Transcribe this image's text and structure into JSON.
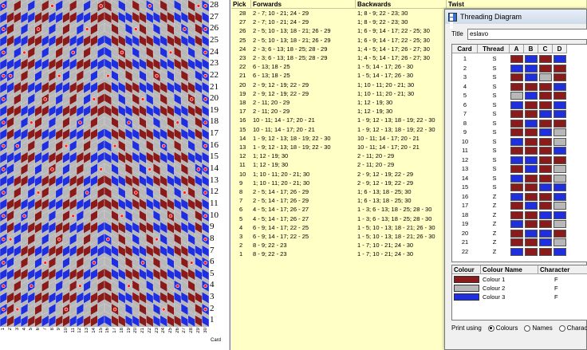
{
  "pattern": {
    "colors": {
      "bg": "#b8b8b8",
      "red": "#8b1a1a",
      "blue": "#1f2fe0",
      "dot_fill": "#ff2020"
    },
    "pick_numbers": [
      "28",
      "27",
      "26",
      "25",
      "24",
      "23",
      "22",
      "21",
      "20",
      "19",
      "18",
      "17",
      "16",
      "15",
      "14",
      "13",
      "12",
      "11",
      "10",
      "9",
      "8",
      "7",
      "6",
      "5",
      "4",
      "3",
      "2",
      "1"
    ],
    "card_numbers": [
      "1",
      "2",
      "3",
      "4",
      "5",
      "6",
      "7",
      "8",
      "9",
      "10",
      "11",
      "12",
      "13",
      "14",
      "15",
      "16",
      "17",
      "18",
      "19",
      "20",
      "21",
      "22",
      "23",
      "24",
      "25",
      "26",
      "27",
      "28",
      "29",
      "30"
    ],
    "card_axis_label": "Card"
  },
  "table": {
    "headers": {
      "pick": "Pick",
      "forwards": "Forwards",
      "backwards": "Backwards",
      "twist": "Twist"
    },
    "rows": [
      {
        "pick": "28",
        "fwd": "2 - 7; 10 - 21; 24 - 29",
        "bwd": "1; 8 - 9; 22 - 23; 30"
      },
      {
        "pick": "27",
        "fwd": "2 - 7; 10 - 21; 24 - 29",
        "bwd": "1; 8 - 9; 22 - 23; 30"
      },
      {
        "pick": "26",
        "fwd": "2 - 5; 10 - 13; 18 - 21; 26 - 29",
        "bwd": "1; 6 - 9; 14 - 17; 22 - 25; 30"
      },
      {
        "pick": "25",
        "fwd": "2 - 5; 10 - 13; 18 - 21; 26 - 29",
        "bwd": "1; 6 - 9; 14 - 17; 22 - 25; 30"
      },
      {
        "pick": "24",
        "fwd": "2 - 3; 6 - 13; 18 - 25; 28 - 29",
        "bwd": "1; 4 - 5; 14 - 17; 26 - 27; 30"
      },
      {
        "pick": "23",
        "fwd": "2 - 3; 6 - 13; 18 - 25; 28 - 29",
        "bwd": "1; 4 - 5; 14 - 17; 26 - 27; 30"
      },
      {
        "pick": "22",
        "fwd": "6 - 13; 18 - 25",
        "bwd": "1 - 5; 14 - 17; 26 - 30"
      },
      {
        "pick": "21",
        "fwd": "6 - 13; 18 - 25",
        "bwd": "1 - 5; 14 - 17; 26 - 30"
      },
      {
        "pick": "20",
        "fwd": "2 - 9; 12 - 19; 22 - 29",
        "bwd": "1; 10 - 11; 20 - 21; 30"
      },
      {
        "pick": "19",
        "fwd": "2 - 9; 12 - 19; 22 - 29",
        "bwd": "1; 10 - 11; 20 - 21; 30"
      },
      {
        "pick": "18",
        "fwd": "2 - 11; 20 - 29",
        "bwd": "1; 12 - 19; 30"
      },
      {
        "pick": "17",
        "fwd": "2 - 11; 20 - 29",
        "bwd": "1; 12 - 19; 30"
      },
      {
        "pick": "16",
        "fwd": "10 - 11; 14 - 17; 20 - 21",
        "bwd": "1 - 9; 12 - 13; 18 - 19; 22 - 30"
      },
      {
        "pick": "15",
        "fwd": "10 - 11; 14 - 17; 20 - 21",
        "bwd": "1 - 9; 12 - 13; 18 - 19; 22 - 30"
      },
      {
        "pick": "14",
        "fwd": "1 - 9; 12 - 13; 18 - 19; 22 - 30",
        "bwd": "10 - 11; 14 - 17; 20 - 21"
      },
      {
        "pick": "13",
        "fwd": "1 - 9; 12 - 13; 18 - 19; 22 - 30",
        "bwd": "10 - 11; 14 - 17; 20 - 21"
      },
      {
        "pick": "12",
        "fwd": "1; 12 - 19; 30",
        "bwd": "2 - 11; 20 - 29"
      },
      {
        "pick": "11",
        "fwd": "1; 12 - 19; 30",
        "bwd": "2 - 11; 20 - 29"
      },
      {
        "pick": "10",
        "fwd": "1; 10 - 11; 20 - 21; 30",
        "bwd": "2 - 9; 12 - 19; 22 - 29"
      },
      {
        "pick": "9",
        "fwd": "1; 10 - 11; 20 - 21; 30",
        "bwd": "2 - 9; 12 - 19; 22 - 29"
      },
      {
        "pick": "8",
        "fwd": "2 - 5; 14 - 17; 26 - 29",
        "bwd": "1; 6 - 13; 18 - 25; 30"
      },
      {
        "pick": "7",
        "fwd": "2 - 5; 14 - 17; 26 - 29",
        "bwd": "1; 6 - 13; 18 - 25; 30"
      },
      {
        "pick": "6",
        "fwd": "4 - 5; 14 - 17; 26 - 27",
        "bwd": "1 - 3; 6 - 13; 18 - 25; 28 - 30"
      },
      {
        "pick": "5",
        "fwd": "4 - 5; 14 - 17; 26 - 27",
        "bwd": "1 - 3; 6 - 13; 18 - 25; 28 - 30"
      },
      {
        "pick": "4",
        "fwd": "6 - 9; 14 - 17; 22 - 25",
        "bwd": "1 - 5; 10 - 13; 18 - 21; 26 - 30"
      },
      {
        "pick": "3",
        "fwd": "6 - 9; 14 - 17; 22 - 25",
        "bwd": "1 - 5; 10 - 13; 18 - 21; 26 - 30"
      },
      {
        "pick": "2",
        "fwd": "8 - 9; 22 - 23",
        "bwd": "1 - 7; 10 - 21; 24 - 30"
      },
      {
        "pick": "1",
        "fwd": "8 - 9; 22 - 23",
        "bwd": "1 - 7; 10 - 21; 24 - 30"
      }
    ]
  },
  "dialog": {
    "title": "Threading Diagram",
    "title_label": "Title",
    "title_value": "eslavo",
    "card_headers": {
      "card": "Card",
      "thread": "Thread",
      "a": "A",
      "b": "B",
      "c": "C",
      "d": "D"
    },
    "cards": [
      {
        "card": "1",
        "thread": "S",
        "cells": [
          "red",
          "blue",
          "red",
          "blue"
        ]
      },
      {
        "card": "2",
        "thread": "S",
        "cells": [
          "blue",
          "blue",
          "red",
          "red"
        ]
      },
      {
        "card": "3",
        "thread": "S",
        "cells": [
          "red",
          "blue",
          "grey",
          "red"
        ]
      },
      {
        "card": "4",
        "thread": "S",
        "cells": [
          "red",
          "red",
          "red",
          "blue"
        ]
      },
      {
        "card": "5",
        "thread": "S",
        "cells": [
          "grey",
          "blue",
          "red",
          "red"
        ]
      },
      {
        "card": "6",
        "thread": "S",
        "cells": [
          "blue",
          "red",
          "red",
          "blue"
        ]
      },
      {
        "card": "7",
        "thread": "S",
        "cells": [
          "red",
          "red",
          "blue",
          "blue"
        ]
      },
      {
        "card": "8",
        "thread": "S",
        "cells": [
          "red",
          "blue",
          "red",
          "red"
        ]
      },
      {
        "card": "9",
        "thread": "S",
        "cells": [
          "red",
          "red",
          "blue",
          "grey"
        ]
      },
      {
        "card": "10",
        "thread": "S",
        "cells": [
          "blue",
          "red",
          "red",
          "grey"
        ]
      },
      {
        "card": "11",
        "thread": "S",
        "cells": [
          "red",
          "red",
          "red",
          "blue"
        ]
      },
      {
        "card": "12",
        "thread": "S",
        "cells": [
          "blue",
          "blue",
          "red",
          "red"
        ]
      },
      {
        "card": "13",
        "thread": "S",
        "cells": [
          "red",
          "blue",
          "red",
          "grey"
        ]
      },
      {
        "card": "14",
        "thread": "S",
        "cells": [
          "blue",
          "red",
          "red",
          "grey"
        ]
      },
      {
        "card": "15",
        "thread": "S",
        "cells": [
          "red",
          "red",
          "blue",
          "blue"
        ]
      },
      {
        "card": "16",
        "thread": "Z",
        "cells": [
          "blue",
          "red",
          "red",
          "blue"
        ]
      },
      {
        "card": "17",
        "thread": "Z",
        "cells": [
          "red",
          "blue",
          "red",
          "grey"
        ]
      },
      {
        "card": "18",
        "thread": "Z",
        "cells": [
          "red",
          "red",
          "blue",
          "blue"
        ]
      },
      {
        "card": "19",
        "thread": "Z",
        "cells": [
          "blue",
          "red",
          "red",
          "grey"
        ]
      },
      {
        "card": "20",
        "thread": "Z",
        "cells": [
          "red",
          "blue",
          "blue",
          "red"
        ]
      },
      {
        "card": "21",
        "thread": "Z",
        "cells": [
          "red",
          "red",
          "blue",
          "grey"
        ]
      },
      {
        "card": "22",
        "thread": "Z",
        "cells": [
          "blue",
          "red",
          "red",
          "blue"
        ]
      }
    ],
    "colour_headers": {
      "colour": "Colour",
      "name": "Colour Name",
      "character": "Character"
    },
    "colours": [
      {
        "swatch": "#8b1a1a",
        "name": "Colour 1",
        "char": "F"
      },
      {
        "swatch": "#b8b8b8",
        "name": "Colour 2",
        "char": "F"
      },
      {
        "swatch": "#1f2fe0",
        "name": "Colour 3",
        "char": "F"
      }
    ],
    "print_label": "Print using",
    "print_options": [
      "Colours",
      "Names",
      "Characters"
    ],
    "print_selected": "Colours"
  }
}
